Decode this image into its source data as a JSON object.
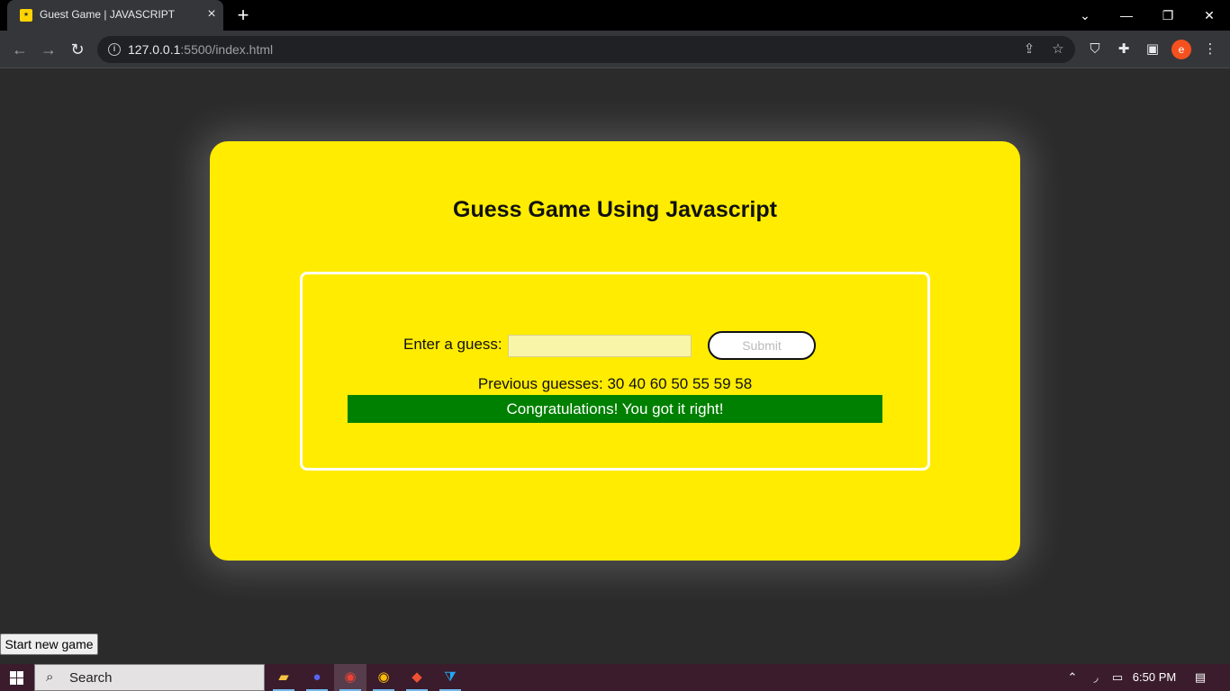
{
  "browser": {
    "tab_title": "Guest Game | JAVASCRIPT",
    "tab_favicon": "favicon-icon",
    "close_tab": "×",
    "new_tab": "+",
    "url_host": "127.0.0.1",
    "url_rest": ":5500/index.html",
    "icons": [
      "back-icon",
      "forward-icon",
      "reload-icon",
      "info-icon",
      "share-icon",
      "star-icon",
      "shield-extension-icon",
      "puzzle-icon",
      "side-panel-icon",
      "menu-icon"
    ],
    "profile_initial": "e"
  },
  "page": {
    "title": "Guess Game Using Javascript",
    "guess_label": "Enter a guess:",
    "guess_value": "",
    "submit_label": "Submit",
    "previous_guesses": "Previous guesses: 30 40 60 50 55 59 58",
    "result_message": "Congratulations! You got it right!",
    "new_game_label": "Start new game"
  },
  "taskbar": {
    "search_placeholder": "Search",
    "apps": [
      "file-explorer-icon",
      "discord-icon",
      "chrome-icon",
      "chrome-icon",
      "git-icon",
      "vscode-icon"
    ],
    "time": "6:50 PM"
  },
  "colors": {
    "card": "#ffec00",
    "success": "#008000",
    "background": "#2b2b2b"
  }
}
